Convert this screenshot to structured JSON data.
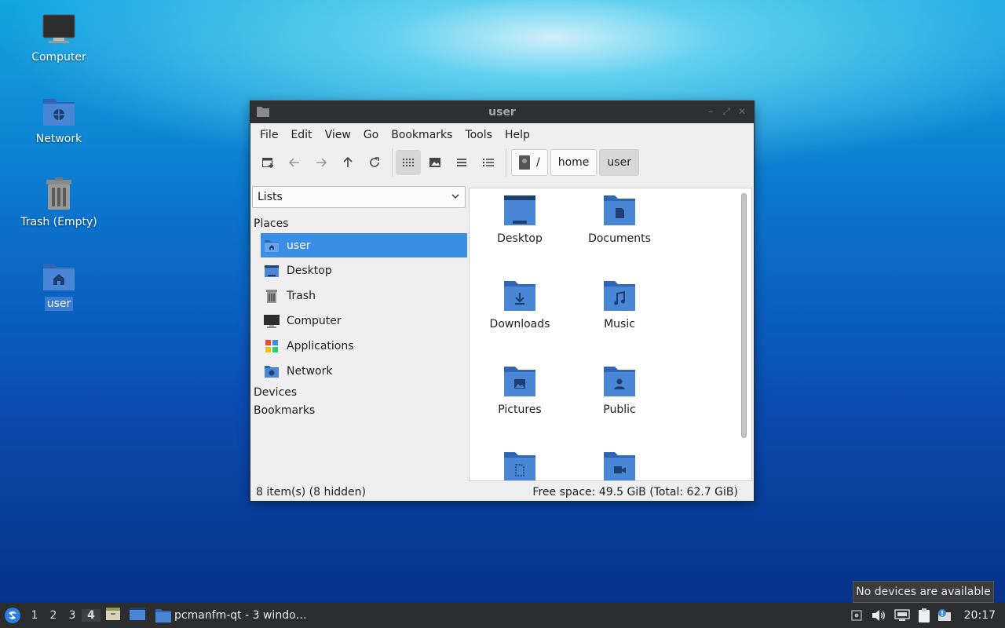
{
  "desktop": {
    "icons": [
      {
        "label": "Computer"
      },
      {
        "label": "Network"
      },
      {
        "label": "Trash (Empty)"
      },
      {
        "label": "user"
      }
    ]
  },
  "window": {
    "title": "user",
    "menu": [
      "File",
      "Edit",
      "View",
      "Go",
      "Bookmarks",
      "Tools",
      "Help"
    ],
    "breadcrumb": [
      "/",
      "home",
      "user"
    ],
    "sidebar": {
      "combo_value": "Lists",
      "places_header": "Places",
      "places": [
        {
          "label": "user",
          "icon": "home-folder-icon"
        },
        {
          "label": "Desktop",
          "icon": "desktop-icon"
        },
        {
          "label": "Trash",
          "icon": "trash-icon"
        },
        {
          "label": "Computer",
          "icon": "computer-icon"
        },
        {
          "label": "Applications",
          "icon": "applications-icon"
        },
        {
          "label": "Network",
          "icon": "network-icon"
        }
      ],
      "devices_header": "Devices",
      "bookmarks_header": "Bookmarks"
    },
    "files": [
      {
        "name": "Desktop",
        "icon": "desktop-folder-icon"
      },
      {
        "name": "Documents",
        "icon": "documents-folder-icon"
      },
      {
        "name": "Downloads",
        "icon": "downloads-folder-icon"
      },
      {
        "name": "Music",
        "icon": "music-folder-icon"
      },
      {
        "name": "Pictures",
        "icon": "pictures-folder-icon"
      },
      {
        "name": "Public",
        "icon": "public-folder-icon"
      },
      {
        "name": "",
        "icon": "templates-folder-icon"
      },
      {
        "name": "",
        "icon": "videos-folder-icon"
      }
    ],
    "status_left": "8 item(s) (8 hidden)",
    "status_right": "Free space: 49.5 GiB (Total: 62.7 GiB)"
  },
  "taskbar": {
    "workspaces": [
      "1",
      "2",
      "3",
      "4"
    ],
    "active_workspace": "4",
    "task_label": "pcmanfm-qt - 3 windo…",
    "clock": "20:17",
    "tooltip": "No devices are available"
  },
  "colors": {
    "accent": "#3a8ee6",
    "folder": "#4a86d6",
    "folder_dark": "#2f65b5",
    "titlebar": "#2e2f30",
    "taskbar": "#2b2d2f"
  }
}
